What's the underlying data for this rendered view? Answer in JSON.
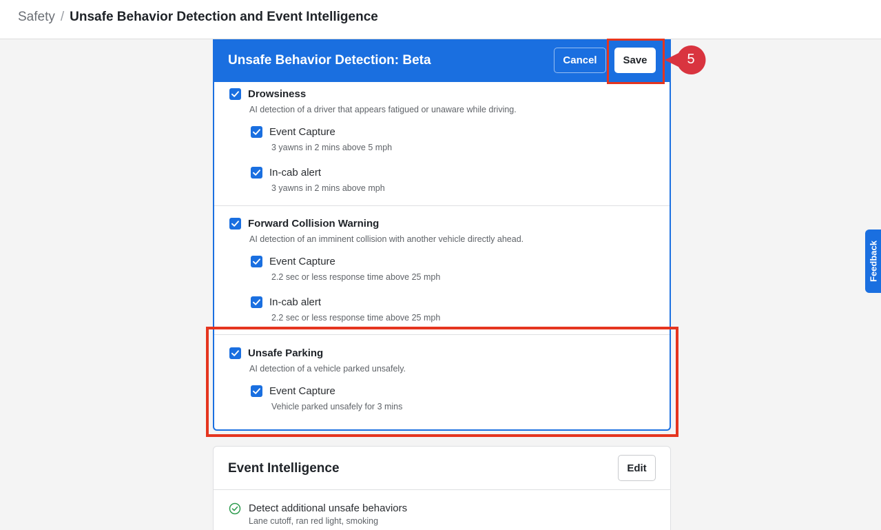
{
  "breadcrumb": {
    "root": "Safety",
    "separator": "/",
    "current": "Unsafe Behavior Detection and Event Intelligence"
  },
  "panel": {
    "title": "Unsafe Behavior Detection: Beta",
    "cancel_label": "Cancel",
    "save_label": "Save",
    "behaviors": [
      {
        "label": "Drowsiness",
        "checked": true,
        "description": "AI detection of a driver that appears fatigued or unaware while driving.",
        "options": [
          {
            "label": "Event Capture",
            "checked": true,
            "description": "3 yawns in 2 mins above 5 mph"
          },
          {
            "label": "In-cab alert",
            "checked": true,
            "description": "3 yawns in 2 mins above mph"
          }
        ]
      },
      {
        "label": "Forward Collision Warning",
        "checked": true,
        "description": "AI detection of an imminent collision with another vehicle directly ahead.",
        "options": [
          {
            "label": "Event Capture",
            "checked": true,
            "description": "2.2 sec or less response time above 25 mph"
          },
          {
            "label": "In-cab alert",
            "checked": true,
            "description": "2.2 sec or less response time above 25 mph"
          }
        ]
      },
      {
        "label": "Unsafe Parking",
        "checked": true,
        "description": "AI detection of a vehicle parked unsafely.",
        "options": [
          {
            "label": "Event Capture",
            "checked": true,
            "description": "Vehicle parked unsafely for 3 mins"
          }
        ]
      }
    ]
  },
  "step_badge": {
    "number": "5"
  },
  "event_intelligence": {
    "title": "Event Intelligence",
    "edit_label": "Edit",
    "items": [
      {
        "label": "Detect additional unsafe behaviors",
        "description": "Lane cutoff, ran red light, smoking",
        "icon": "check-circle-icon"
      }
    ]
  },
  "feedback": {
    "label": "Feedback"
  },
  "colors": {
    "accent": "#1a6fe0",
    "highlight": "#e5351f",
    "success": "#2e9c4f"
  }
}
